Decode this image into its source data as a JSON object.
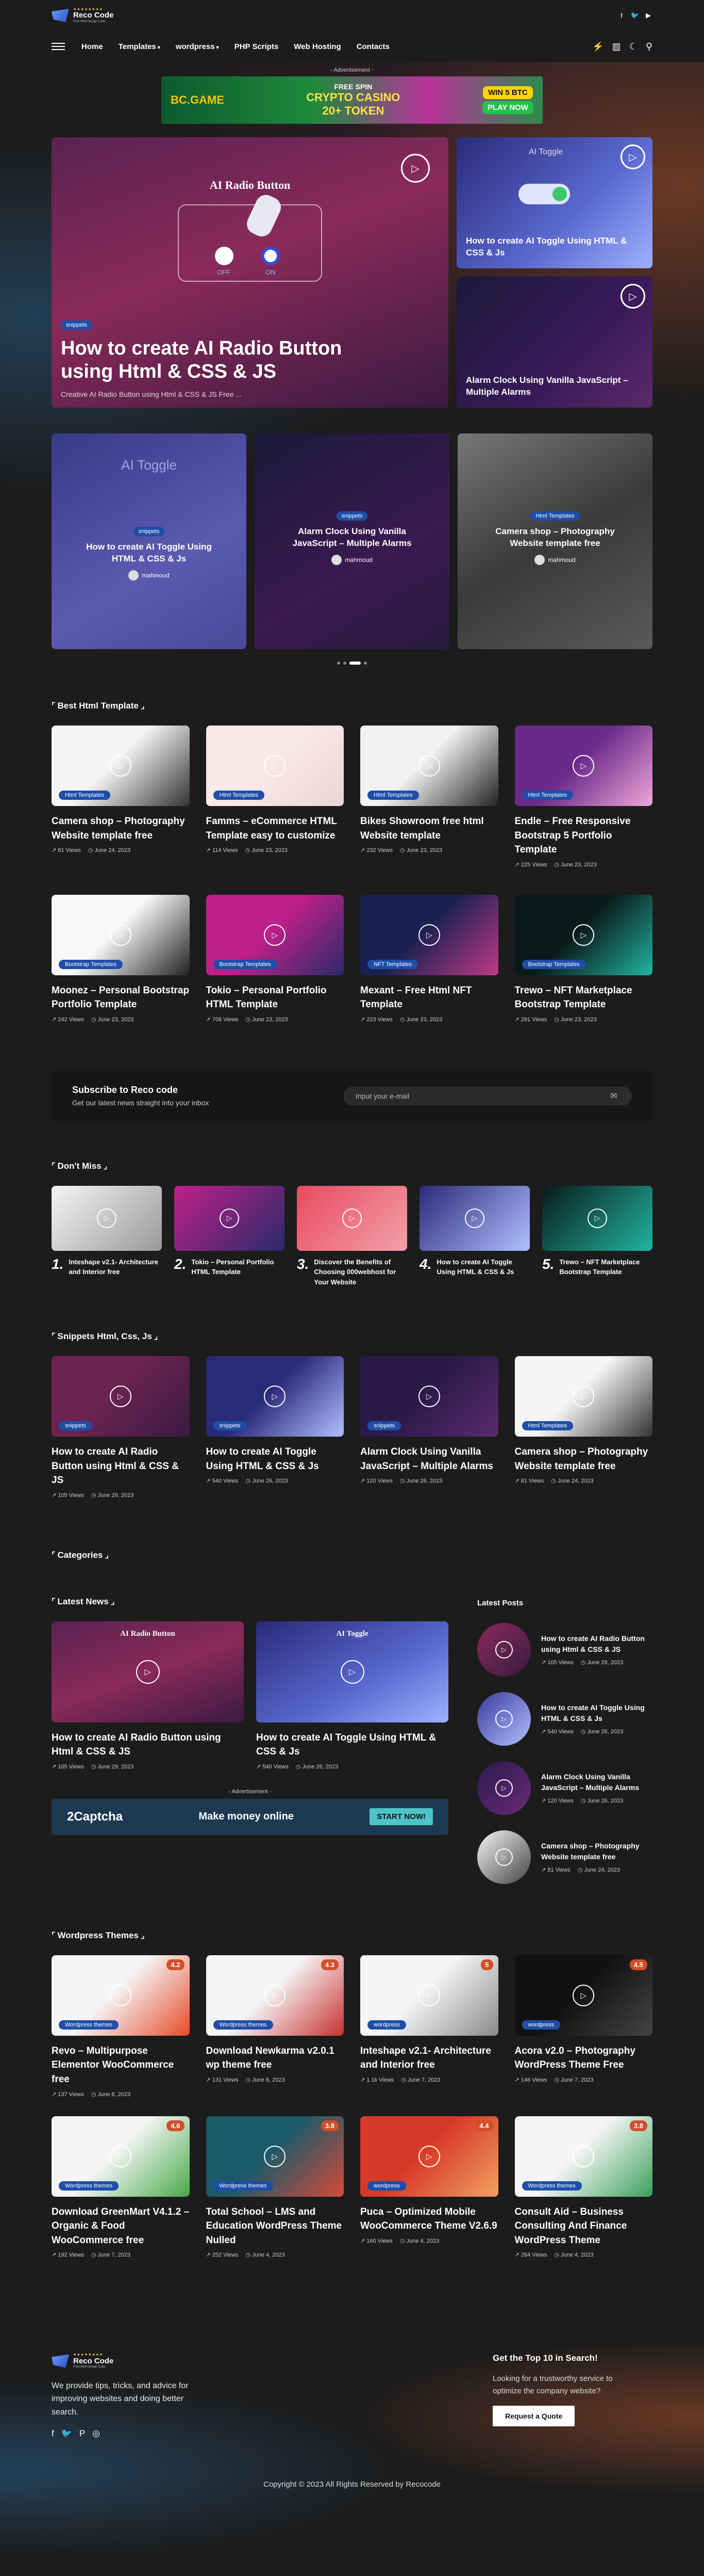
{
  "header": {
    "site_name": "Reco Code",
    "tagline": "Free Web Design Code",
    "socials": [
      "facebook-icon",
      "twitter-icon",
      "youtube-icon"
    ]
  },
  "nav": {
    "items": [
      {
        "label": "Home"
      },
      {
        "label": "Templates",
        "dropdown": true
      },
      {
        "label": "wordpress",
        "dropdown": true
      },
      {
        "label": "PHP Scripts"
      },
      {
        "label": "Web Hosting"
      },
      {
        "label": "Contacts"
      }
    ]
  },
  "ads": {
    "label": "- Advertisement -",
    "banner": {
      "brand": "BC.GAME",
      "line1": "FREE SPIN",
      "line2": "CRYPTO CASINO",
      "line3": "20+ TOKEN",
      "btn1": "WIN 5 BTC",
      "btn2": "PLAY NOW"
    }
  },
  "hero": {
    "main": {
      "image_title": "AI Radio Button",
      "off": "OFF",
      "on": "ON",
      "badge": "snippets",
      "title": "How to create AI Radio Button using Html & CSS & JS",
      "excerpt": "Creative AI Radio Button using Html & CSS & JS Free ..."
    },
    "side": [
      {
        "title": "How to create AI Toggle Using HTML & CSS & Js",
        "image_title": "AI Toggle"
      },
      {
        "title": "Alarm Clock Using Vanilla JavaScript – Multiple Alarms"
      }
    ],
    "row": [
      {
        "image_title": "AI Toggle",
        "badge": "snippets",
        "title": "How to create AI Toggle Using HTML & CSS & Js",
        "author": "mahmoud"
      },
      {
        "badge": "snippets",
        "title": "Alarm Clock Using Vanilla JavaScript – Multiple Alarms",
        "author": "mahmoud"
      },
      {
        "badge": "Html Templates",
        "title": "Camera shop – Photography Website template free",
        "author": "mahmoud"
      }
    ]
  },
  "best": {
    "title": "Best Html Template",
    "posts": [
      {
        "tag": "Html Templates",
        "title": "Camera shop – Photography Website template free",
        "views": "81 Views",
        "date": "June 24, 2023",
        "c1": "#f5f5f5",
        "c2": "#333333"
      },
      {
        "tag": "Html Templates",
        "title": "Famms – eCommerce HTML Template easy to customize",
        "views": "114 Views",
        "date": "June 23, 2023",
        "c1": "#fbe9e9",
        "c2": "#e9d6d2"
      },
      {
        "tag": "Html Templates",
        "title": "Bikes Showroom free html Website template",
        "views": "232 Views",
        "date": "June 23, 2023",
        "c1": "#f2f2f2",
        "c2": "#222222"
      },
      {
        "tag": "Html Templates",
        "title": "Endle – Free Responsive Bootstrap 5 Portfolio Template",
        "views": "225 Views",
        "date": "June 23, 2023",
        "c1": "#6a2a8a",
        "c2": "#f0a6d8"
      },
      {
        "tag": "Bootstrap Templates",
        "title": "Moonez – Personal Bootstrap Portfolio Template",
        "views": "242 Views",
        "date": "June 23, 2023",
        "c1": "#f8f8f8",
        "c2": "#222222"
      },
      {
        "tag": "Bootstrap Templates",
        "title": "Tokio – Personal Portfolio HTML Template",
        "views": "706 Views",
        "date": "June 23, 2023",
        "c1": "#c0208a",
        "c2": "#2a2a6a"
      },
      {
        "tag": "NFT Templates",
        "title": "Mexant – Free Html NFT Template",
        "views": "223 Views",
        "date": "June 23, 2023",
        "c1": "#1a2050",
        "c2": "#c03a8a"
      },
      {
        "tag": "Bootstrap Templates",
        "title": "Trewo – NFT Marketplace Bootstrap Template",
        "views": "291 Views",
        "date": "June 23, 2023",
        "c1": "#0a1a1a",
        "c2": "#22b5a0"
      }
    ]
  },
  "subscribe": {
    "title": "Subscribe to Reco code",
    "text": "Get our latest news straight into your inbox",
    "placeholder": "Input your e-mail"
  },
  "dontmiss": {
    "title": "Don't Miss",
    "posts": [
      {
        "n": "1.",
        "title": "Inteshape v2.1- Architecture and Interior free",
        "c1": "#f5f5f5",
        "c2": "#999999"
      },
      {
        "n": "2.",
        "title": "Tokio – Personal Portfolio HTML Template",
        "c1": "#c0208a",
        "c2": "#2a2a6a"
      },
      {
        "n": "3.",
        "title": "Discover the Benefits of Choosing 000webhost for Your Website",
        "c1": "#e84a5f",
        "c2": "#f2a0a8"
      },
      {
        "n": "4.",
        "title": "How to create AI Toggle Using HTML & CSS & Js",
        "c1": "#2a2a7a",
        "c2": "#b0c0ff"
      },
      {
        "n": "5.",
        "title": "Trewo – NFT Marketplace Bootstrap Template",
        "c1": "#0a1a1a",
        "c2": "#22b5a0"
      }
    ]
  },
  "snippets": {
    "title": "Snippets Html, Css, Js",
    "posts": [
      {
        "tag": "snippets",
        "title": "How to create AI Radio Button using Html & CSS & JS",
        "views": "105 Views",
        "date": "June 29, 2023",
        "c1": "#6a2350",
        "c2": "#3a1a40"
      },
      {
        "tag": "snippets",
        "title": "How to create AI Toggle Using HTML & CSS & Js",
        "views": "540 Views",
        "date": "June 26, 2023",
        "c1": "#2a2a7a",
        "c2": "#b0c0ff"
      },
      {
        "tag": "snippets",
        "title": "Alarm Clock Using Vanilla JavaScript – Multiple Alarms",
        "views": "120 Views",
        "date": "June 26, 2023",
        "c1": "#2a1a4a",
        "c2": "#5a2a6a"
      },
      {
        "tag": "Html Templates",
        "title": "Camera shop – Photography Website template free",
        "views": "81 Views",
        "date": "June 24, 2023",
        "c1": "#f5f5f5",
        "c2": "#333333"
      }
    ]
  },
  "categories": {
    "title": "Categories"
  },
  "latest": {
    "title": "Latest News",
    "posts": [
      {
        "title": "How to create AI Radio Button using Html & CSS & JS",
        "views": "105 Views",
        "date": "June 29, 2023",
        "image_title": "AI Radio Button"
      },
      {
        "title": "How to create AI Toggle Using HTML & CSS & Js",
        "views": "540 Views",
        "date": "June 26, 2023",
        "image_title": "AI Toggle"
      }
    ],
    "ad_label": "- Advertisement -",
    "ad": {
      "brand": "2Captcha",
      "text": "Make money online",
      "btn": "START NOW!"
    }
  },
  "latest_posts": {
    "title": "Latest Posts",
    "posts": [
      {
        "title": "How to create AI Radio Button using Html & CSS & JS",
        "views": "105 Views",
        "date": "June 29, 2023",
        "c1": "#8a2a5a",
        "c2": "#3a1a40"
      },
      {
        "title": "How to create AI Toggle Using HTML & CSS & Js",
        "views": "540 Views",
        "date": "June 26, 2023",
        "c1": "#3a3a9a",
        "c2": "#b0c0ff"
      },
      {
        "title": "Alarm Clock Using Vanilla JavaScript – Multiple Alarms",
        "views": "120 Views",
        "date": "June 26, 2023",
        "c1": "#2a1a4a",
        "c2": "#6a2a7a"
      },
      {
        "title": "Camera shop – Photography Website template free",
        "views": "81 Views",
        "date": "June 24, 2023",
        "c1": "#f5f5f5",
        "c2": "#444444"
      }
    ]
  },
  "wordpress": {
    "title": "Wordpress Themes",
    "posts": [
      {
        "tag": "Wordpress themes",
        "rating": "4.2",
        "title": "Revo – Multipurpose Elementor WooCommerce free",
        "views": "137 Views",
        "date": "June 8, 2023",
        "c1": "#f5f5f5",
        "c2": "#e84a2a"
      },
      {
        "tag": "Wordpress themes",
        "rating": "4.3",
        "title": "Download Newkarma v2.0.1 wp theme free",
        "views": "131 Views",
        "date": "June 8, 2023",
        "c1": "#f5f5f5",
        "c2": "#c83030"
      },
      {
        "tag": "wordpress",
        "rating": "5",
        "title": "Inteshape v2.1- Architecture and Interior free",
        "views": "1.1k Views",
        "date": "June 7, 2023",
        "c1": "#f5f5f5",
        "c2": "#888888"
      },
      {
        "tag": "wordpress",
        "rating": "4.5",
        "title": "Acora v2.0 – Photography WordPress Theme Free",
        "views": "146 Views",
        "date": "June 7, 2023",
        "c1": "#111111",
        "c2": "#444444"
      },
      {
        "tag": "Wordpress themes",
        "rating": "4.6",
        "title": "Download GreenMart V4.1.2 – Organic & Food WooCommerce free",
        "views": "192 Views",
        "date": "June 7, 2023",
        "c1": "#f5f5f5",
        "c2": "#4aa84a"
      },
      {
        "tag": "Wordpress themes",
        "rating": "3.8",
        "title": "Total School – LMS and Education WordPress Theme Nulled",
        "views": "252 Views",
        "date": "June 4, 2023",
        "c1": "#1a5a6a",
        "c2": "#d84a3a"
      },
      {
        "tag": "wordpress",
        "rating": "4.4",
        "title": "Puca – Optimized Mobile WooCommerce Theme V2.6.9",
        "views": "160 Views",
        "date": "June 4, 2023",
        "c1": "#d83a2a",
        "c2": "#f0a060"
      },
      {
        "tag": "Wordpress themes",
        "rating": "3.8",
        "title": "Consult Aid – Business Consulting And Finance WordPress Theme",
        "views": "284 Views",
        "date": "June 4, 2023",
        "c1": "#f5f5f5",
        "c2": "#3aa05a"
      }
    ]
  },
  "footer": {
    "site_name": "Reco Code",
    "tagline": "Free Web Design Code",
    "text": "We provide tips, tricks, and advice for improving websites and doing better search.",
    "cta_title": "Get the Top 10 in Search!",
    "cta_text": "Looking for a trustworthy service to optimize the company website?",
    "cta_btn": "Request a Quote",
    "copyright": "Copyright © 2023 All Rights Reserved by Recocode"
  }
}
